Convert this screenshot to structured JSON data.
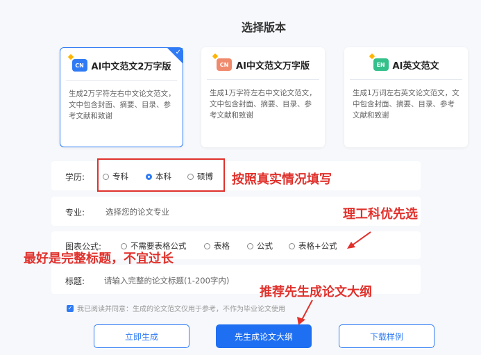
{
  "title": "选择版本",
  "cards": [
    {
      "badge": "CN",
      "badge_color": "#2f7bf5",
      "name": "AI中文范文2万字版",
      "desc": "生成2万字符左右中文论文范文，文中包含封面、摘要、目录、参考文献和致谢"
    },
    {
      "badge": "CN",
      "badge_color": "#f08a6c",
      "name": "AI中文范文万字版",
      "desc": "生成1万字符左右中文论文范文，文中包含封面、摘要、目录、参考文献和致谢"
    },
    {
      "badge": "EN",
      "badge_color": "#34c08a",
      "name": "AI英文范文",
      "desc": "生成1万词左右英文论文范文，文中包含封面、摘要、目录、参考文献和致谢"
    }
  ],
  "selected_check": "✓",
  "education": {
    "label": "学历:",
    "options": [
      "专科",
      "本科",
      "硕博"
    ],
    "selected": "本科"
  },
  "major": {
    "label": "专业:",
    "placeholder": "选择您的论文专业"
  },
  "formula": {
    "label": "图表公式:",
    "options": [
      "不需要表格公式",
      "表格",
      "公式",
      "表格+公式"
    ]
  },
  "paper_title": {
    "label": "标题:",
    "placeholder": "请输入完整的论文标题(1-200字内)"
  },
  "agreement": "我已阅读并同意：生成的论文范文仅用于参考，不作为毕业论文使用",
  "buttons": {
    "generate": "立即生成",
    "outline": "先生成论文大纲",
    "download": "下载样例"
  },
  "annotations": {
    "fill_truth": "按照真实情况填写",
    "prefer_stem": "理工科优先选",
    "complete_title": "最好是完整标题，不宜过长",
    "recommend_outline": "推荐先生成论文大纲"
  },
  "colors": {
    "accent": "#2f7bf5",
    "annotation": "#e0312c"
  }
}
